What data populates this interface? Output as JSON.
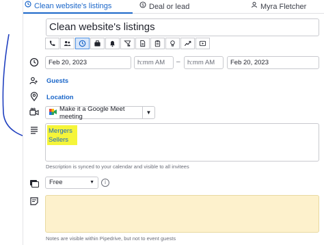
{
  "tabs": [
    {
      "label": "Clean website's listings",
      "icon": "clock-icon",
      "active": true
    },
    {
      "label": "Deal or lead",
      "icon": "dollar-icon",
      "active": false
    },
    {
      "label": "Myra Fletcher",
      "icon": "person-icon",
      "active": false
    }
  ],
  "activity": {
    "title": "Clean website's listings",
    "types": [
      "call-icon",
      "meeting-icon",
      "task-icon",
      "deadline-icon",
      "alarm-icon",
      "lunch-icon",
      "document-icon",
      "clipboard-icon",
      "idea-icon",
      "chart-icon",
      "video-icon"
    ],
    "selected_type_index": 2
  },
  "dates": {
    "start_date": "Feb 20, 2023",
    "start_time_placeholder": "h:mm AM",
    "separator": "–",
    "end_time_placeholder": "h:mm AM",
    "end_date": "Feb 20, 2023"
  },
  "guests_label": "Guests",
  "location_label": "Location",
  "meeting_button_label": "Make it a Google Meet meeting",
  "description": {
    "lines": [
      "Mergers",
      "Sellers"
    ],
    "hint": "Description is synced to your calendar and visible to all invitees"
  },
  "busy": {
    "value": "Free"
  },
  "notes": {
    "hint": "Notes are visible within Pipedrive, but not to event guests"
  },
  "colors": {
    "accent": "#1a66c9",
    "highlight": "#f5f53a",
    "notes_bg": "#fdf1cc",
    "annotation": "#1f3fbf"
  }
}
